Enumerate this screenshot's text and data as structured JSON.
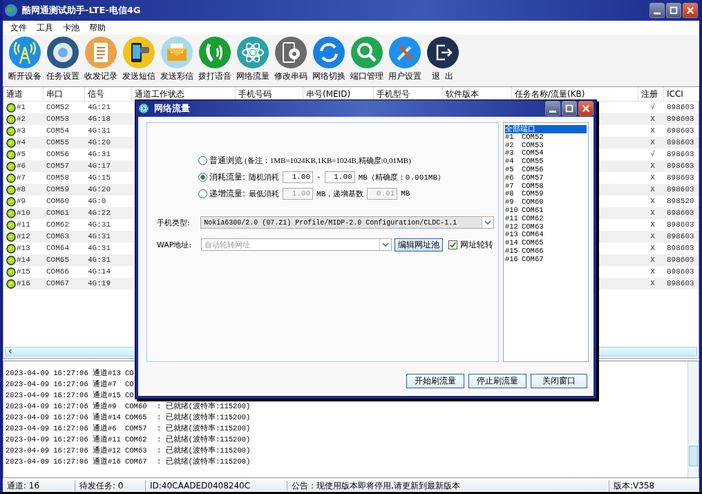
{
  "window": {
    "title": "酷网通测试助手-LTE-电信4G"
  },
  "menu": [
    "文件",
    "工具",
    "卡池",
    "帮助"
  ],
  "toolbar": [
    "断开设备",
    "任务设置",
    "收发记录",
    "发送短信",
    "发送彩信",
    "拨打语音",
    "网络流量",
    "修改串码",
    "网络切换",
    "端口管理",
    "用户设置",
    "退  出"
  ],
  "table": {
    "columns": [
      "通道",
      "串口",
      "信号",
      "通道工作状态",
      "手机号码",
      "串号(MEID)",
      "手机型号",
      "软件版本",
      "任务名称/流量(KB)",
      "注册",
      "ICCI"
    ],
    "rows": [
      {
        "channel": "#1",
        "port": "COM52",
        "signal": "4G:21",
        "register": "√",
        "iccid": "898603"
      },
      {
        "channel": "#2",
        "port": "COM53",
        "signal": "4G:18",
        "register": "X",
        "iccid": "898603"
      },
      {
        "channel": "#3",
        "port": "COM54",
        "signal": "4G:31",
        "register": "X",
        "iccid": "898603"
      },
      {
        "channel": "#4",
        "port": "COM55",
        "signal": "4G:20",
        "register": "X",
        "iccid": "898603"
      },
      {
        "channel": "#5",
        "port": "COM56",
        "signal": "4G:31",
        "register": "√",
        "iccid": "898603"
      },
      {
        "channel": "#6",
        "port": "COM57",
        "signal": "4G:17",
        "register": "X",
        "iccid": "898603"
      },
      {
        "channel": "#7",
        "port": "COM58",
        "signal": "4G:15",
        "register": "X",
        "iccid": "898603"
      },
      {
        "channel": "#8",
        "port": "COM59",
        "signal": "4G:20",
        "register": "X",
        "iccid": "898603"
      },
      {
        "channel": "#9",
        "port": "COM60",
        "signal": "4G:0",
        "register": "X",
        "iccid": "898520"
      },
      {
        "channel": "#10",
        "port": "COM61",
        "signal": "4G:22",
        "register": "X",
        "iccid": "898603"
      },
      {
        "channel": "#11",
        "port": "COM62",
        "signal": "4G:31",
        "register": "X",
        "iccid": "898603"
      },
      {
        "channel": "#12",
        "port": "COM63",
        "signal": "4G:31",
        "register": "X",
        "iccid": "898603"
      },
      {
        "channel": "#13",
        "port": "COM64",
        "signal": "4G:31",
        "register": "X",
        "iccid": "898603"
      },
      {
        "channel": "#14",
        "port": "COM65",
        "signal": "4G:31",
        "register": "X",
        "iccid": "898603"
      },
      {
        "channel": "#15",
        "port": "COM66",
        "signal": "4G:14",
        "register": "X",
        "iccid": "898603"
      },
      {
        "channel": "#16",
        "port": "COM67",
        "signal": "4G:19",
        "register": "X",
        "iccid": "898603"
      }
    ]
  },
  "log": [
    {
      "time": "2023-04-09 16:27:06",
      "channel": "通道#13",
      "port": "CO"
    },
    {
      "time": "2023-04-09 16:27:06",
      "channel": "通道#7",
      "port": "CO"
    },
    {
      "time": "2023-04-09 16:27:06",
      "channel": "通道#15",
      "port": "CO"
    },
    {
      "time": "2023-04-09 16:27:06",
      "channel": "通道#9",
      "port": "COM60",
      "status": ": 已就绪(波特率:115200)"
    },
    {
      "time": "2023-04-09 16:27:06",
      "channel": "通道#14",
      "port": "COM65",
      "status": ": 已就绪(波特率:115200)"
    },
    {
      "time": "2023-04-09 16:27:06",
      "channel": "通道#6",
      "port": "COM57",
      "status": ": 已就绪(波特率:115200)"
    },
    {
      "time": "2023-04-09 16:27:06",
      "channel": "通道#11",
      "port": "COM62",
      "status": ": 已就绪(波特率:115200)"
    },
    {
      "time": "2023-04-09 16:27:06",
      "channel": "通道#12",
      "port": "COM63",
      "status": ": 已就绪(波特率:115200)"
    },
    {
      "time": "2023-04-09 16:27:06",
      "channel": "通道#16",
      "port": "COM67",
      "status": ": 已就绪(波特率:115200)"
    }
  ],
  "status_bar": [
    "通道: 16",
    "待发任务: 0",
    "ID:40CAADED0408240C",
    "公告：现使用版本即将停用,请更新到最新版本",
    "版本:V358"
  ],
  "dialog": {
    "title": "网络流量",
    "modes": [
      {
        "kind": "note",
        "label": "普通浏览",
        "selected": false,
        "note": "(备注：1MB=1024KB,1KB=1024B,精确度:0,01MB)"
      },
      {
        "kind": "range",
        "label": "消耗流量:",
        "selected": true,
        "disabled": false,
        "prefix": "随机消耗",
        "from": "1.00",
        "mid": "-",
        "to": "1.00",
        "suffix": "MB（精确度：0.001MB）"
      },
      {
        "kind": "range",
        "label": "递增流量:",
        "selected": false,
        "disabled": true,
        "prefix": "最低消耗",
        "from": "1.00",
        "mid": "MB，递增基数",
        "to": "0.01",
        "suffix": "MB"
      }
    ],
    "phone_type": {
      "label": "手机类型:",
      "value": "Nokia6300/2.0 (07.21) Profile/MIDP-2.0 Configuration/CLDC-1.1"
    },
    "wap": {
      "label": "WAP地址:",
      "value": "自动轮转网址",
      "disabled": true
    },
    "edit_button": "编辑网址池",
    "rotate": {
      "label": "网址轮转",
      "checked": true
    },
    "ports": [
      {
        "index": "全部端口",
        "selected": true
      },
      {
        "index": "#1",
        "name": "COM52",
        "selected": false
      },
      {
        "index": "#2",
        "name": "COM53",
        "selected": false
      },
      {
        "index": "#3",
        "name": "COM54",
        "selected": false
      },
      {
        "index": "#4",
        "name": "COM55",
        "selected": false
      },
      {
        "index": "#5",
        "name": "COM56",
        "selected": false
      },
      {
        "index": "#6",
        "name": "COM57",
        "selected": false
      },
      {
        "index": "#7",
        "name": "COM58",
        "selected": false
      },
      {
        "index": "#8",
        "name": "COM59",
        "selected": false
      },
      {
        "index": "#9",
        "name": "COM60",
        "selected": false
      },
      {
        "index": "#10",
        "name": "COM61",
        "selected": false
      },
      {
        "index": "#11",
        "name": "COM62",
        "selected": false
      },
      {
        "index": "#12",
        "name": "COM63",
        "selected": false
      },
      {
        "index": "#13",
        "name": "COM64",
        "selected": false
      },
      {
        "index": "#14",
        "name": "COM65",
        "selected": false
      },
      {
        "index": "#15",
        "name": "COM66",
        "selected": false
      },
      {
        "index": "#16",
        "name": "COM67",
        "selected": false
      }
    ],
    "buttons": [
      "开始刷流量",
      "停止刷流量",
      "关闭窗口"
    ]
  }
}
